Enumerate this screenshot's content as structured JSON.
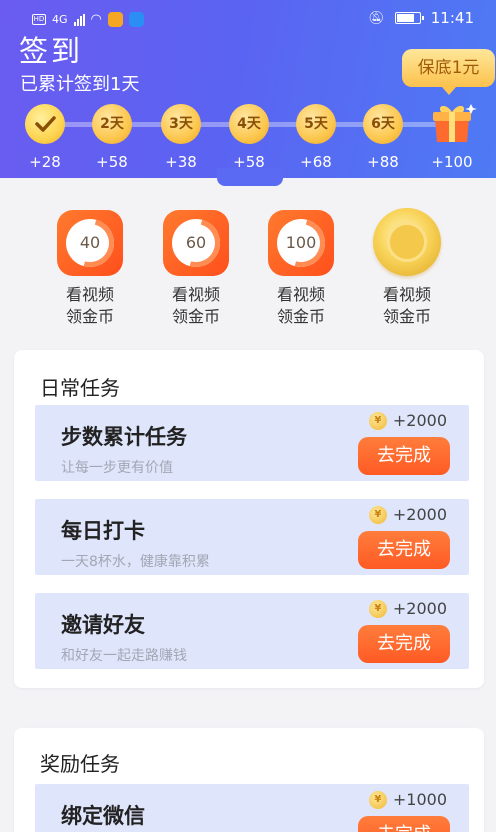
{
  "status_bar": {
    "time": "11:41",
    "network": "HD",
    "signal": "4G"
  },
  "header": {
    "title": "签到",
    "subtitle": "已累计签到1天",
    "bonus_badge": "保底1元",
    "days": [
      {
        "label": "",
        "reward": "+28",
        "checked": true
      },
      {
        "label": "2天",
        "reward": "+58"
      },
      {
        "label": "3天",
        "reward": "+38"
      },
      {
        "label": "4天",
        "reward": "+58"
      },
      {
        "label": "5天",
        "reward": "+68"
      },
      {
        "label": "6天",
        "reward": "+88"
      },
      {
        "label": "",
        "reward": "+100",
        "icon": "gift-box-icon"
      }
    ]
  },
  "videos": [
    {
      "value": "40",
      "line1": "看视频",
      "line2": "领金币"
    },
    {
      "value": "60",
      "line1": "看视频",
      "line2": "领金币"
    },
    {
      "value": "100",
      "line1": "看视频",
      "line2": "领金币"
    },
    {
      "value": "",
      "line1": "看视频",
      "line2": "领金币",
      "icon": "gold-coin-icon"
    }
  ],
  "daily": {
    "title": "日常任务",
    "tasks": [
      {
        "name": "步数累计任务",
        "desc": "让每一步更有价值",
        "reward": "+2000",
        "button": "去完成"
      },
      {
        "name": "每日打卡",
        "desc": "一天8杯水，健康靠积累",
        "reward": "+2000",
        "button": "去完成"
      },
      {
        "name": "邀请好友",
        "desc": "和好友一起走路赚钱",
        "reward": "+2000",
        "button": "去完成"
      }
    ]
  },
  "reward_tasks": {
    "title": "奖励任务",
    "tasks": [
      {
        "name": "绑定微信",
        "reward": "+1000",
        "button": "去完成"
      }
    ]
  },
  "colors": {
    "primary": "#5b63f2",
    "accent": "#ff5a24",
    "gold": "#fcc24d"
  }
}
